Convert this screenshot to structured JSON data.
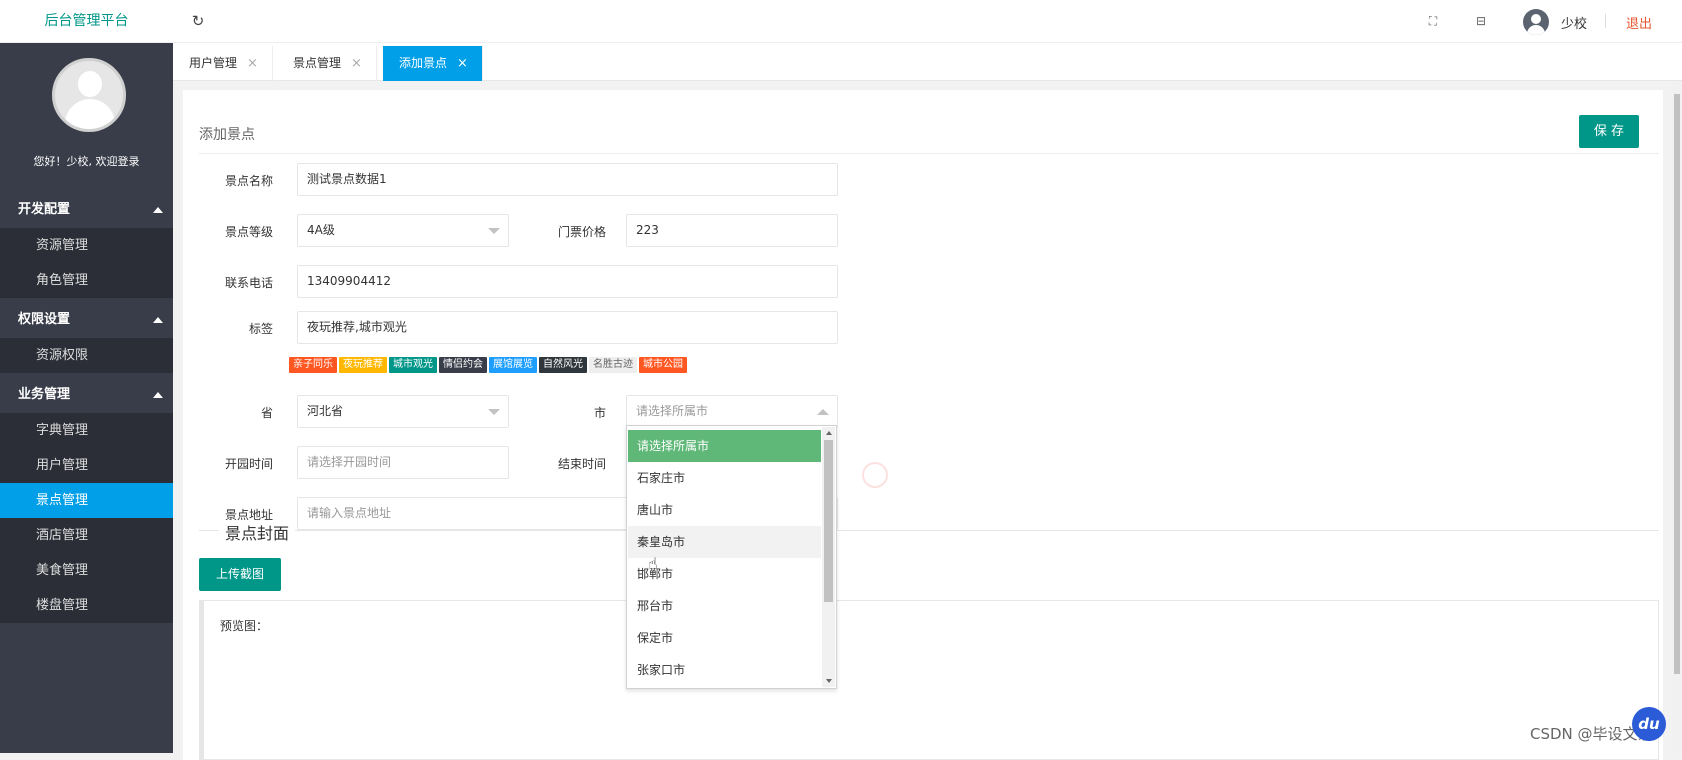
{
  "header": {
    "logo": "后台管理平台",
    "username": "少校",
    "logout": "退出"
  },
  "sidebar": {
    "welcome": "您好！少校, 欢迎登录",
    "groups": [
      {
        "label": "开发配置",
        "items": [
          "资源管理",
          "角色管理"
        ]
      },
      {
        "label": "权限设置",
        "items": [
          "资源权限"
        ]
      },
      {
        "label": "业务管理",
        "items": [
          "字典管理",
          "用户管理",
          "景点管理",
          "酒店管理",
          "美食管理",
          "楼盘管理"
        ]
      }
    ],
    "active_item": "景点管理"
  },
  "tabs": [
    {
      "label": "用户管理",
      "close": "×",
      "active": false
    },
    {
      "label": "景点管理",
      "close": "×",
      "active": false
    },
    {
      "label": "添加景点",
      "close": "×",
      "active": true
    }
  ],
  "form": {
    "title": "添加景点",
    "save_label": "保 存",
    "name_label": "景点名称",
    "name_value": "测试景点数据1",
    "level_label": "景点等级",
    "level_value": "4A级",
    "price_label": "门票价格",
    "price_value": "223",
    "phone_label": "联系电话",
    "phone_value": "13409904412",
    "tag_label": "标签",
    "tag_value": "夜玩推荐,城市观光",
    "tags": [
      {
        "text": "亲子同乐",
        "color": "#ff5722"
      },
      {
        "text": "夜玩推荐",
        "color": "#ffb800"
      },
      {
        "text": "城市观光",
        "color": "#009688"
      },
      {
        "text": "情侣约会",
        "color": "#393d49"
      },
      {
        "text": "展馆展览",
        "color": "#1e9fff"
      },
      {
        "text": "自然风光",
        "color": "#2f363c"
      },
      {
        "text": "名胜古迹",
        "color": "#eeeeee"
      },
      {
        "text": "城市公园",
        "color": "#ff5722"
      }
    ],
    "province_label": "省",
    "province_value": "河北省",
    "city_label": "市",
    "city_placeholder": "请选择所属市",
    "open_label": "开园时间",
    "open_placeholder": "请选择开园时间",
    "close_label": "结束时间",
    "address_label": "景点地址",
    "address_placeholder": "请输入景点地址",
    "cover_legend": "景点封面",
    "upload_label": "上传截图",
    "preview_label": "预览图："
  },
  "city_dropdown": {
    "options": [
      "请选择所属市",
      "石家庄市",
      "唐山市",
      "秦皇岛市",
      "邯郸市",
      "邢台市",
      "保定市",
      "张家口市"
    ],
    "selected_index": 0,
    "hover_index": 3
  },
  "watermark": "CSDN @毕设文家",
  "bubble": "du"
}
